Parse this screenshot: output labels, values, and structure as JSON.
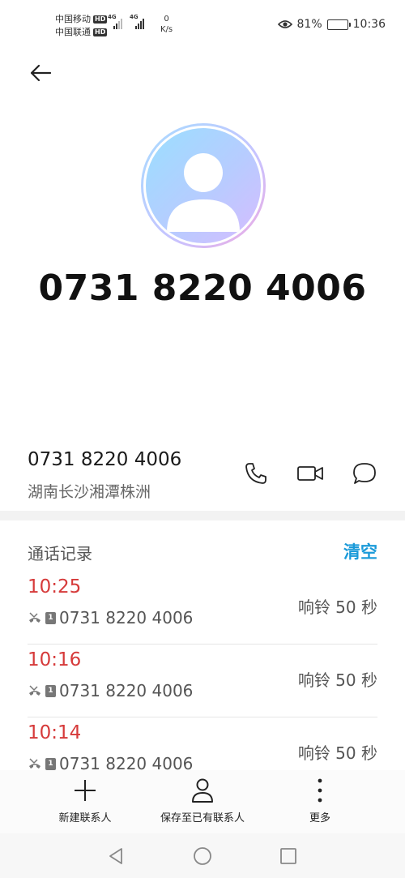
{
  "status_bar": {
    "carrier1": "中国移动",
    "carrier2": "中国联通",
    "hd_label": "HD",
    "network_tag": "4G",
    "net_speed_value": "0",
    "net_speed_unit": "K/s",
    "battery_percent": "81%",
    "battery_level": 0.81,
    "time": "10:36"
  },
  "header": {
    "number": "0731 8220 4006"
  },
  "contact": {
    "number": "0731 8220 4006",
    "location": "湖南长沙湘潭株洲"
  },
  "call_log": {
    "title": "通话记录",
    "clear_label": "清空",
    "entries": [
      {
        "time": "10:25",
        "sim": "1",
        "number": "0731 8220 4006",
        "duration": "响铃 50 秒"
      },
      {
        "time": "10:16",
        "sim": "1",
        "number": "0731 8220 4006",
        "duration": "响铃 50 秒"
      },
      {
        "time": "10:14",
        "sim": "1",
        "number": "0731 8220 4006",
        "duration": "响铃 50 秒"
      }
    ]
  },
  "bottom_actions": {
    "new_contact": "新建联系人",
    "save_existing": "保存至已有联系人",
    "more": "更多"
  },
  "colors": {
    "missed_call": "#d63a3a",
    "accent": "#1a9ad9"
  }
}
